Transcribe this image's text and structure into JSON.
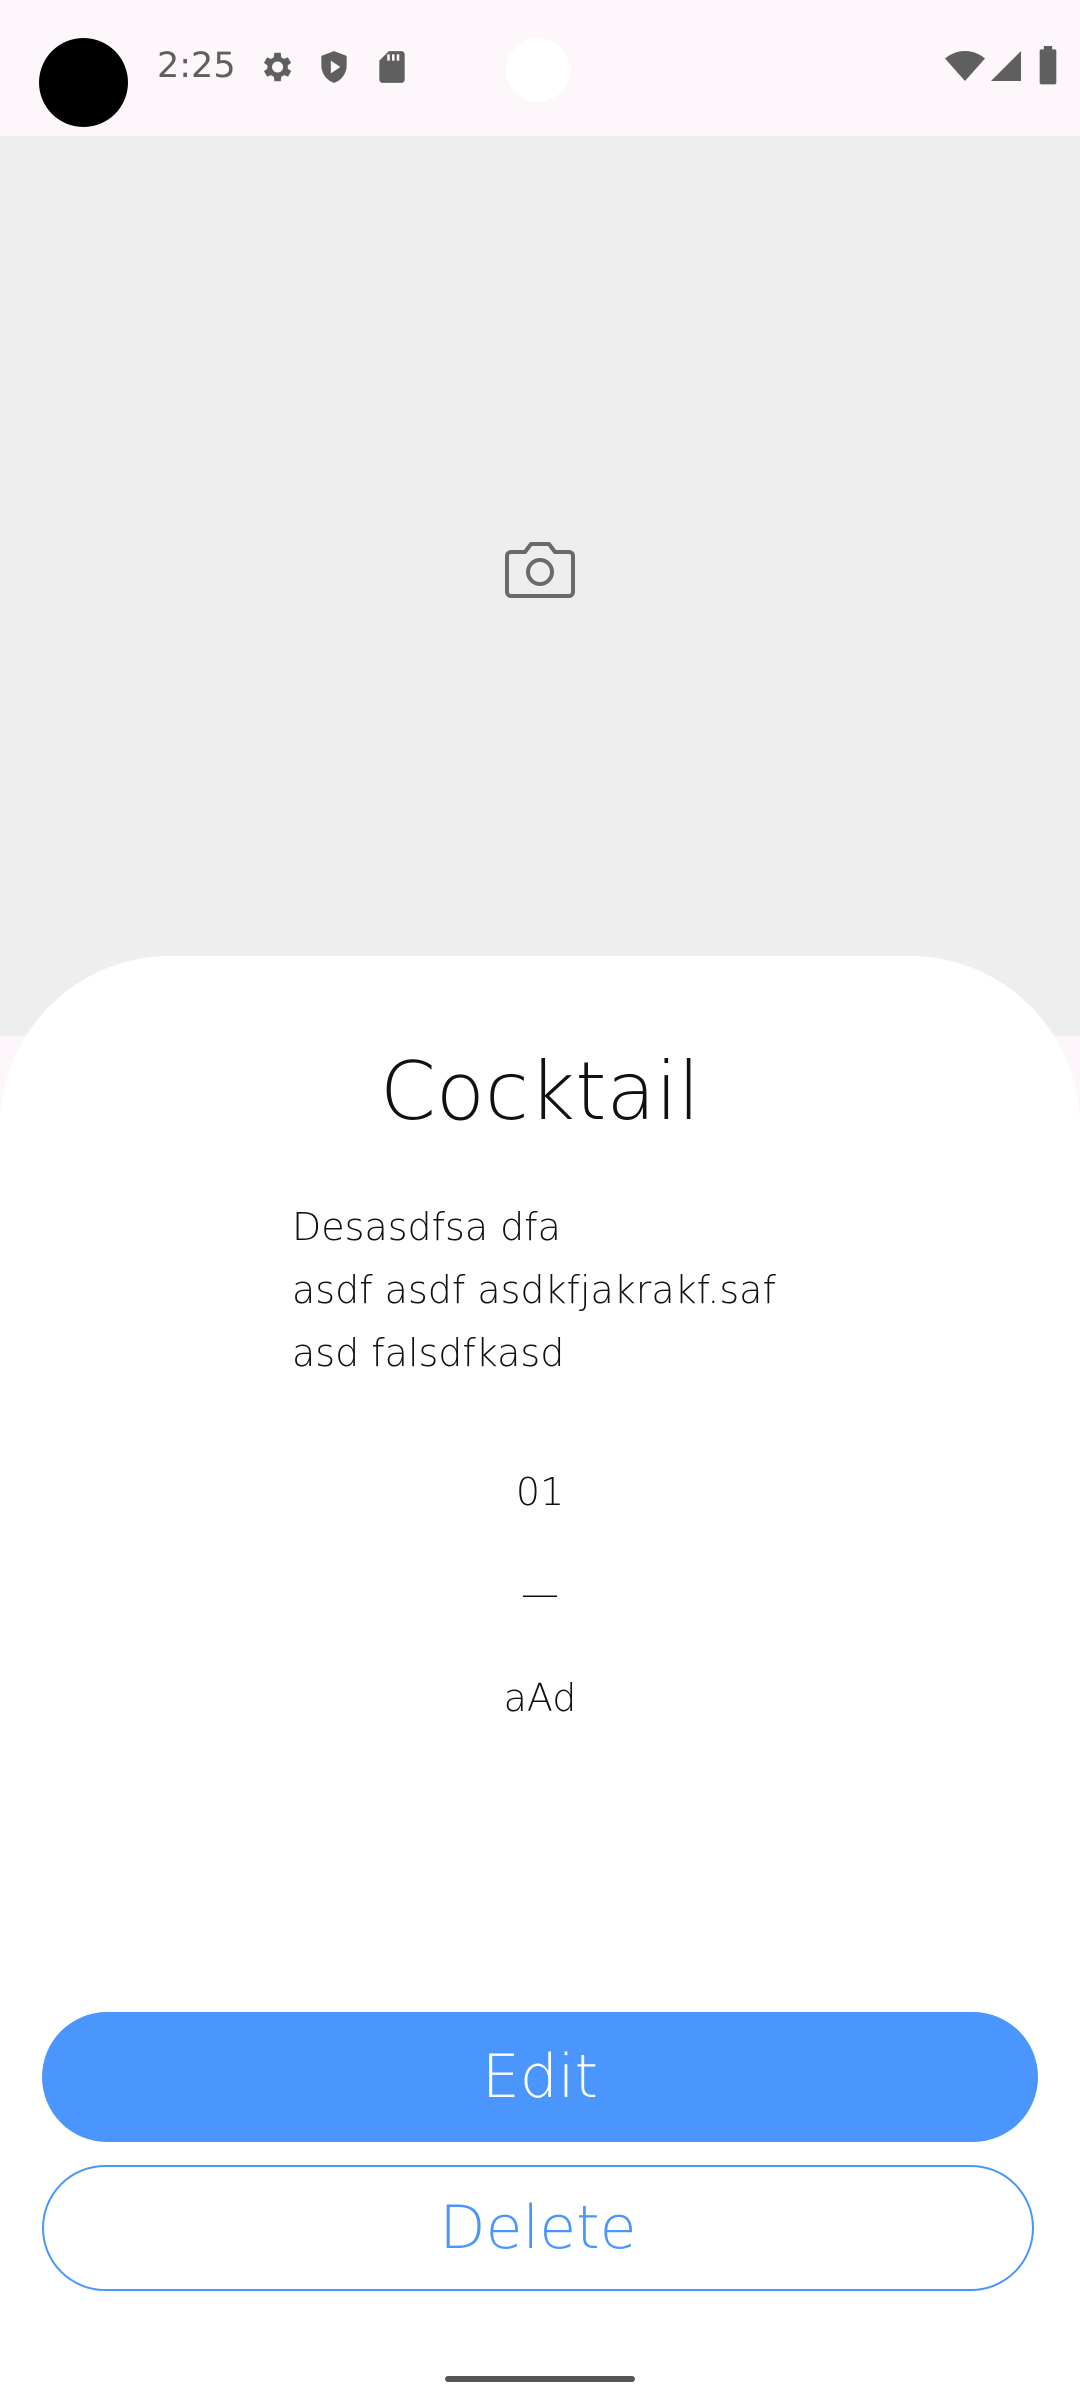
{
  "status_bar": {
    "time": "2:25",
    "icons": [
      "settings-icon",
      "shield-play-icon",
      "sd-card-icon",
      "wifi-icon",
      "signal-icon",
      "battery-icon"
    ]
  },
  "image_placeholder": {
    "icon": "camera-icon"
  },
  "cocktail": {
    "title": "Cocktail",
    "description": "Desasdfsa dfa\n asdf asdf asdkfjakrakf.saf\nasd falsdfkasd",
    "line1": "01",
    "line2": "—",
    "line3": "aAd"
  },
  "actions": {
    "edit_label": "Edit",
    "delete_label": "Delete"
  },
  "colors": {
    "accent": "#4a96fc",
    "image_bg": "#eeeeee",
    "sheet_bg": "#ffffff",
    "status_bg": "#fdf7fb"
  }
}
